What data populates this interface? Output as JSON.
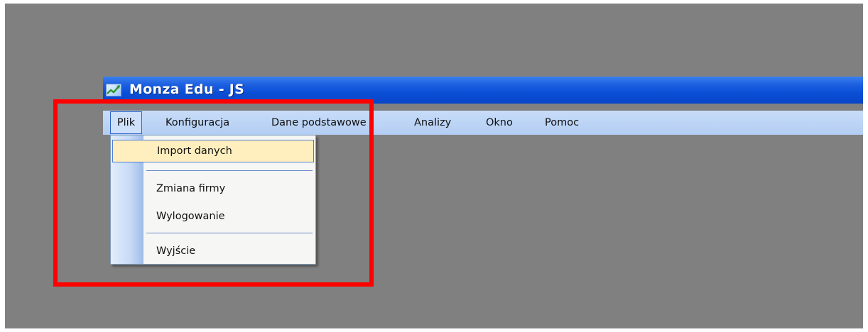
{
  "window": {
    "title": "Monza Edu - JS",
    "icon": "app-chart-icon"
  },
  "menubar": {
    "items": [
      {
        "label": "Plik",
        "active": true
      },
      {
        "label": "Konfiguracja"
      },
      {
        "label": "Dane podstawowe"
      },
      {
        "label": "Analizy"
      },
      {
        "label": "Okno"
      },
      {
        "label": "Pomoc"
      }
    ]
  },
  "dropdown": {
    "items": [
      {
        "label": "Import danych",
        "hovered": true
      },
      {
        "label": "Zmiana firmy"
      },
      {
        "label": "Wylogowanie"
      },
      {
        "label": "Wyjście"
      }
    ]
  },
  "annotation": {
    "color": "#ff0000"
  },
  "colors": {
    "desktop": "#808080",
    "titlebar": "#0a4fd6",
    "menubar": "#b3cdf3",
    "menu_hover": "#ffefbf"
  }
}
